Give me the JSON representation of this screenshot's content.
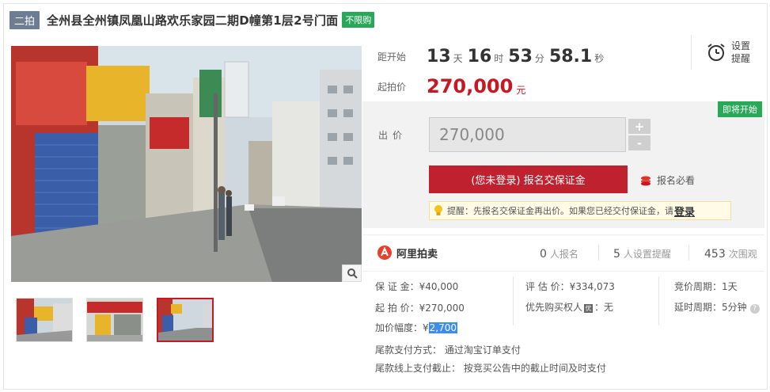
{
  "header": {
    "round_badge": "二拍",
    "title": "全州县全州镇凤凰山路欢乐家园二期D幢第1层2号门面",
    "tag": "不限购"
  },
  "timer": {
    "label": "距开始",
    "days": "13",
    "days_unit": "天",
    "hours": "16",
    "hours_unit": "时",
    "minutes": "53",
    "minutes_unit": "分",
    "seconds": "58.1",
    "seconds_unit": "秒"
  },
  "remind": {
    "line1": "设置",
    "line2": "提醒",
    "icon": "alarm-clock-icon"
  },
  "start_price": {
    "label": "起拍价",
    "value": "270,000",
    "unit": "元"
  },
  "bid": {
    "status_tag": "即将开始",
    "label": "出价",
    "input_value": "270,000",
    "plus": "+",
    "minus": "-",
    "signup_button": "(您未登录) 报名交保证金",
    "must_read": "报名必看",
    "tip_prefix": "提醒：先报名交保证金再出价。如果您已经交付保证金，请",
    "tip_login": "登录"
  },
  "platform": {
    "name": "阿里拍卖",
    "logo": "ali-auction-logo"
  },
  "stats": {
    "signups": "0",
    "signups_label": "人报名",
    "reminders": "5",
    "reminders_label": "人设置提醒",
    "views": "453",
    "views_label": "次围观"
  },
  "details": {
    "deposit_label": "保 证 金：",
    "deposit_value": "¥40,000",
    "start_label": "起 拍 价：",
    "start_value": "¥270,000",
    "increment_label": "加价幅度：",
    "increment_currency": "¥",
    "increment_value": "2,700",
    "appraisal_label": "评 估 价：",
    "appraisal_value": "¥334,073",
    "priority_label": "优先购买权人",
    "priority_badge": "优",
    "priority_value": "：无",
    "cycle_label": "竞价周期：",
    "cycle_value": "1天",
    "delay_label": "延时周期：",
    "delay_value": "5分钟",
    "final_pay_method": "尾款支付方式： 通过淘宝订单支付",
    "final_pay_deadline": "尾款线上支付截止： 按竞买公告中的截止时间及时支付"
  },
  "colors": {
    "accent": "#c81623",
    "green_tag": "#29a85a",
    "badge": "#6e7d94",
    "highlight": "#3b8fe8"
  }
}
